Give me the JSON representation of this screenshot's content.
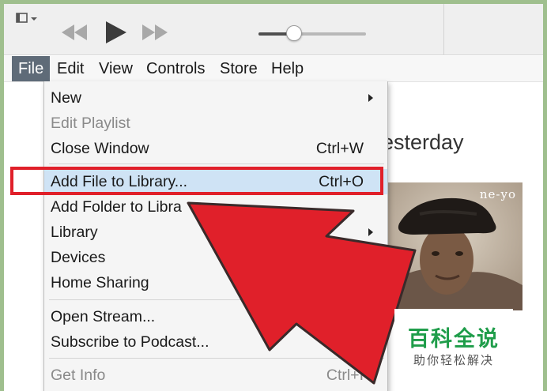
{
  "menubar": {
    "items": [
      {
        "label": "File",
        "active": true
      },
      {
        "label": "Edit"
      },
      {
        "label": "View"
      },
      {
        "label": "Controls"
      },
      {
        "label": "Store"
      },
      {
        "label": "Help"
      }
    ]
  },
  "toolbar": {
    "sidebar_toggle_icon": "sidebar-toggle-icon",
    "prev_icon": "rewind-icon",
    "play_icon": "play-icon",
    "next_icon": "fast-forward-icon",
    "volume_level": 0.33
  },
  "file_menu": {
    "items": [
      {
        "label": "New",
        "submenu": true
      },
      {
        "label": "Edit Playlist",
        "disabled": true
      },
      {
        "label": "Close Window",
        "shortcut": "Ctrl+W"
      },
      {
        "label": "Add File to Library...",
        "shortcut": "Ctrl+O",
        "highlighted": true
      },
      {
        "label": "Add Folder to Libra"
      },
      {
        "label": "Library",
        "submenu": true
      },
      {
        "label": "Devices"
      },
      {
        "label": "Home Sharing"
      },
      {
        "label": "Open Stream..."
      },
      {
        "label": "Subscribe to Podcast..."
      },
      {
        "label": "Get Info",
        "shortcut": "Ctrl+I",
        "disabled": true
      }
    ]
  },
  "content": {
    "album_title_visible": "esterday",
    "album_art_logo": "ne-yo"
  },
  "annotation": {
    "highlight_color": "#e0202a",
    "arrow_color": "#e0202a"
  },
  "watermark": {
    "title": "百科全说",
    "subtitle": "助你轻松解决",
    "color": "#1f9d4a"
  }
}
